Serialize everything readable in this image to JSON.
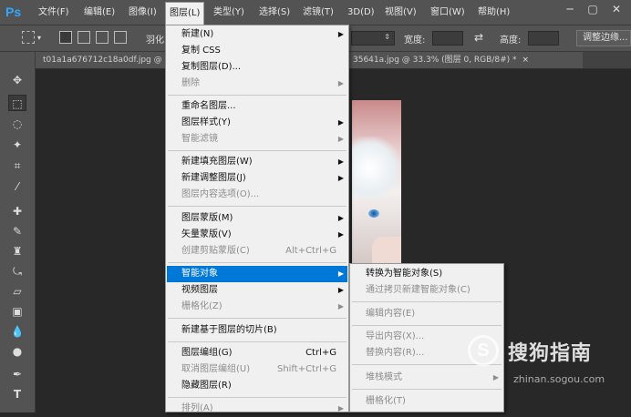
{
  "app": {
    "logo": "Ps"
  },
  "menubar": {
    "items": [
      "文件(F)",
      "编辑(E)",
      "图像(I)",
      "图层(L)",
      "类型(Y)",
      "选择(S)",
      "滤镜(T)",
      "3D(D)",
      "视图(V)",
      "窗口(W)",
      "帮助(H)"
    ],
    "active_index": 3
  },
  "options_bar": {
    "feather_label": "羽化",
    "width_label": "宽度:",
    "height_label": "高度:",
    "refine_edge_button": "调整边缘..."
  },
  "document_tabs": [
    {
      "label": "t01a1a676712c18a0df.jpg @",
      "close": "×"
    },
    {
      "label": "35641a.jpg @ 33.3% (图层 0, RGB/8#) *",
      "close": "×"
    }
  ],
  "layer_menu": {
    "items": [
      {
        "label": "新建(N)",
        "submenu": true,
        "disabled": false
      },
      {
        "label": "复制 CSS",
        "disabled": false
      },
      {
        "label": "复制图层(D)...",
        "disabled": false
      },
      {
        "label": "删除",
        "submenu": true,
        "disabled": true
      },
      {
        "separator": true
      },
      {
        "label": "重命名图层...",
        "disabled": false
      },
      {
        "label": "图层样式(Y)",
        "submenu": true,
        "disabled": false
      },
      {
        "label": "智能滤镜",
        "submenu": true,
        "disabled": true
      },
      {
        "separator": true
      },
      {
        "label": "新建填充图层(W)",
        "submenu": true,
        "disabled": false
      },
      {
        "label": "新建调整图层(J)",
        "submenu": true,
        "disabled": false
      },
      {
        "label": "图层内容选项(O)...",
        "disabled": true
      },
      {
        "separator": true
      },
      {
        "label": "图层蒙版(M)",
        "submenu": true,
        "disabled": false
      },
      {
        "label": "矢量蒙版(V)",
        "submenu": true,
        "disabled": false
      },
      {
        "label": "创建剪贴蒙版(C)",
        "shortcut": "Alt+Ctrl+G",
        "disabled": true
      },
      {
        "separator": true
      },
      {
        "label": "智能对象",
        "submenu": true,
        "disabled": false,
        "highlighted": true
      },
      {
        "label": "视频图层",
        "submenu": true,
        "disabled": false
      },
      {
        "label": "栅格化(Z)",
        "submenu": true,
        "disabled": true
      },
      {
        "separator": true
      },
      {
        "label": "新建基于图层的切片(B)",
        "disabled": false
      },
      {
        "separator": true
      },
      {
        "label": "图层编组(G)",
        "shortcut": "Ctrl+G",
        "disabled": false
      },
      {
        "label": "取消图层编组(U)",
        "shortcut": "Shift+Ctrl+G",
        "disabled": true
      },
      {
        "label": "隐藏图层(R)",
        "disabled": false
      },
      {
        "separator": true
      },
      {
        "label": "排列(A)",
        "submenu": true,
        "disabled": true
      }
    ]
  },
  "smart_object_submenu": {
    "items": [
      {
        "label": "转换为智能对象(S)",
        "disabled": false
      },
      {
        "label": "通过拷贝新建智能对象(C)",
        "disabled": true
      },
      {
        "separator": true
      },
      {
        "label": "编辑内容(E)",
        "disabled": true
      },
      {
        "separator": true
      },
      {
        "label": "导出内容(X)...",
        "disabled": true
      },
      {
        "label": "替换内容(R)...",
        "disabled": true
      },
      {
        "separator": true
      },
      {
        "label": "堆栈模式",
        "submenu": true,
        "disabled": true
      },
      {
        "separator": true
      },
      {
        "label": "栅格化(T)",
        "disabled": true
      }
    ]
  },
  "watermark": {
    "logo_letter": "S",
    "text": "搜狗指南",
    "url": "zhinan.sogou.com"
  },
  "colors": {
    "highlight": "#0078d7",
    "menubar": "#535353",
    "canvas": "#282828"
  }
}
